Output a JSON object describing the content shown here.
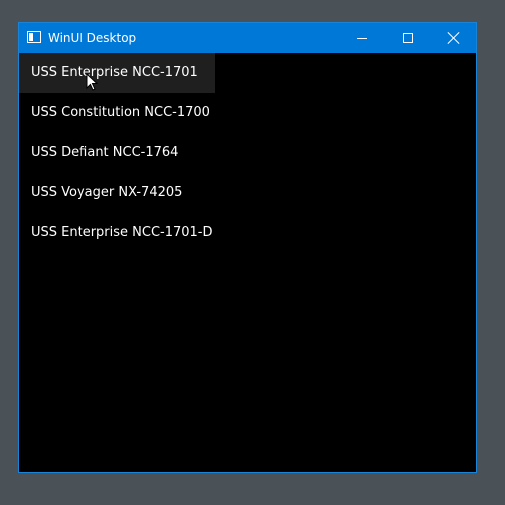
{
  "window": {
    "title": "WinUI Desktop",
    "titlebar_color": "#0078d7",
    "background_color": "#000000",
    "controls": {
      "minimize_icon": "minimize-icon",
      "maximize_icon": "maximize-icon",
      "close_icon": "close-icon"
    }
  },
  "list": {
    "items": [
      {
        "label": "USS Enterprise NCC-1701"
      },
      {
        "label": "USS Constitution NCC-1700"
      },
      {
        "label": "USS Defiant NCC-1764"
      },
      {
        "label": "USS Voyager NX-74205"
      },
      {
        "label": "USS Enterprise NCC-1701-D"
      }
    ],
    "hover_color": "#1f1f1f"
  }
}
